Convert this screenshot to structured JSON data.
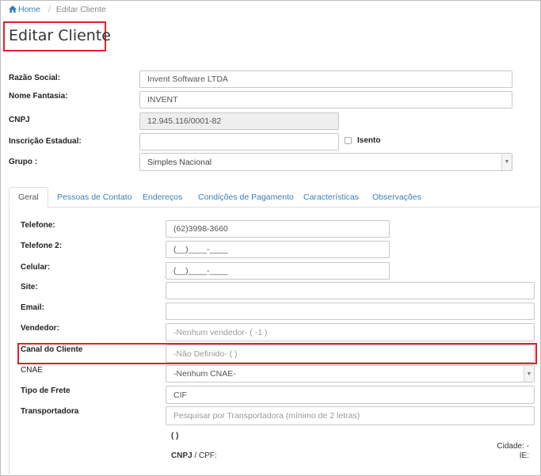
{
  "breadcrumb": {
    "home_icon": "home-icon",
    "home_label": "Home",
    "separator": "/",
    "current": "Editar Cliente"
  },
  "page_title": "Editar Cliente",
  "form": {
    "razao_social": {
      "label": "Razão Social:",
      "value": "Invent Software LTDA"
    },
    "nome_fantasia": {
      "label": "Nome Fantasia:",
      "value": "INVENT"
    },
    "cnpj": {
      "label": "CNPJ",
      "value": "12.945.116/0001-82"
    },
    "inscricao_estadual": {
      "label": "Inscrição Estadual:",
      "value": ""
    },
    "isento": {
      "label": "Isento",
      "checked": false
    },
    "grupo": {
      "label": "Grupo :",
      "value": "Simples Nacional"
    }
  },
  "tabs": [
    {
      "label": "Geral",
      "active": true
    },
    {
      "label": "Pessoas de Contato",
      "active": false
    },
    {
      "label": "Endereços",
      "active": false
    },
    {
      "label": "Condições de Pagamento",
      "active": false
    },
    {
      "label": "Características",
      "active": false
    },
    {
      "label": "Observações",
      "active": false
    }
  ],
  "geral": {
    "telefone": {
      "label": "Telefone:",
      "value": "(62)3998-3660"
    },
    "telefone2": {
      "label": "Telefone 2:",
      "value": "(__)____-____"
    },
    "celular": {
      "label": "Celular:",
      "value": "(__)____-____"
    },
    "site": {
      "label": "Site:",
      "value": ""
    },
    "email": {
      "label": "Email:",
      "value": ""
    },
    "vendedor": {
      "label": "Vendedor:",
      "value": "-Nenhum vendedor- ( -1 )"
    },
    "canal": {
      "label": "Canal do Cliente",
      "value": "-Não Definido- ( )"
    },
    "cnae": {
      "label": "CNAE",
      "value": "-Nenhum CNAE-"
    },
    "tipo_frete": {
      "label": "Tipo de Frete",
      "value": "CIF"
    },
    "transportadora": {
      "label": "Transportadora",
      "placeholder": "Pesquisar por Transportadora (mínimo de 2 letras)"
    },
    "transp_name": "( )",
    "cnpj_cpf_bold": "CNPJ",
    "cnpj_cpf_rest": " / CPF:",
    "cidade": "Cidade: -",
    "ie": "IE:"
  },
  "colors": {
    "highlight": "#e0202a",
    "link": "#3a7fb8"
  }
}
